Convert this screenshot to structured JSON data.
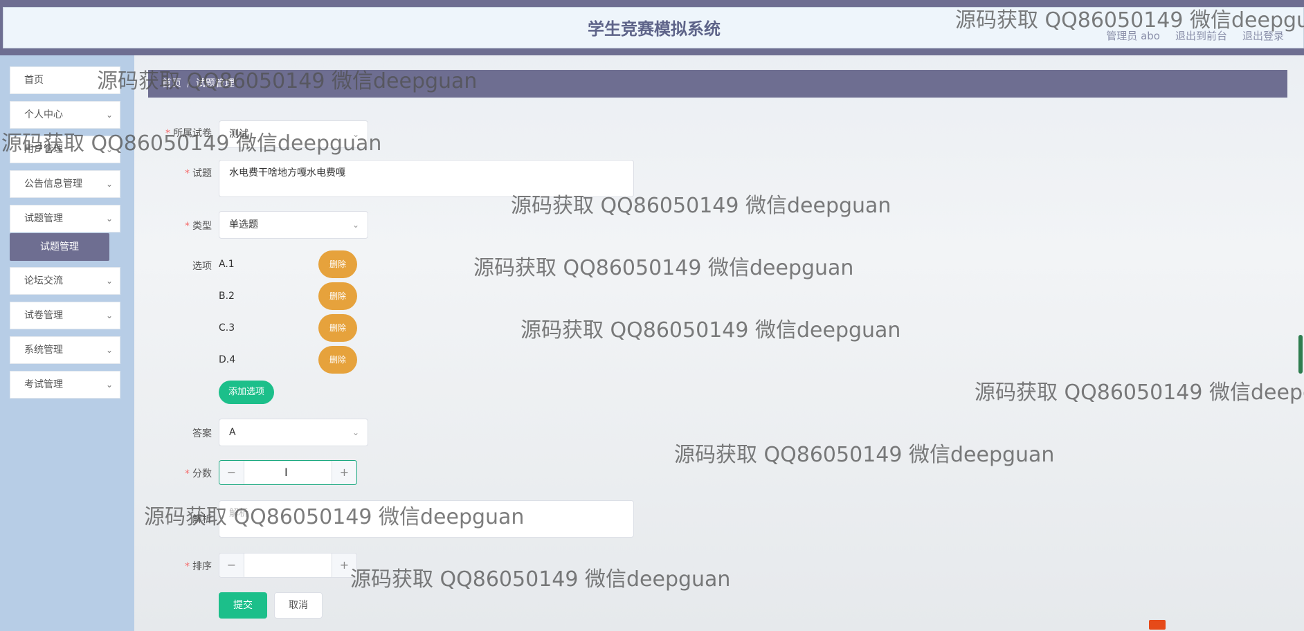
{
  "header": {
    "title": "学生竞赛模拟系统",
    "admin_label": "管理员 abo",
    "to_front_label": "退出到前台",
    "logout_label": "退出登录"
  },
  "sidebar": {
    "items": [
      {
        "label": "首页",
        "has_chevron": false
      },
      {
        "label": "个人中心",
        "has_chevron": true
      },
      {
        "label": "用户管理",
        "has_chevron": true
      },
      {
        "label": "公告信息管理",
        "has_chevron": true
      },
      {
        "label": "试题管理",
        "has_chevron": true
      },
      {
        "label": "论坛交流",
        "has_chevron": true
      },
      {
        "label": "试卷管理",
        "has_chevron": true
      },
      {
        "label": "系统管理",
        "has_chevron": true
      },
      {
        "label": "考试管理",
        "has_chevron": true
      }
    ],
    "active_subitem": "试题管理"
  },
  "breadcrumb": {
    "home": "首页",
    "sep": "/",
    "current": "试题管理"
  },
  "form": {
    "paper": {
      "label": "所属试卷",
      "value": "测试"
    },
    "question": {
      "label": "试题",
      "value": "水电费干啥地方嘎水电费嘎"
    },
    "type": {
      "label": "类型",
      "value": "单选题"
    },
    "options": {
      "label": "选项",
      "items": [
        "A.1",
        "B.2",
        "C.3",
        "D.4"
      ],
      "delete_label": "删除",
      "add_label": "添加选项"
    },
    "answer": {
      "label": "答案",
      "value": "A"
    },
    "score": {
      "label": "分数",
      "value": ""
    },
    "analysis": {
      "label": "解析",
      "placeholder": "解析"
    },
    "sort": {
      "label": "排序",
      "value": ""
    },
    "submit_label": "提交",
    "cancel_label": "取消"
  },
  "watermark_text": "源码获取 QQ86050149 微信deepguan",
  "colors": {
    "header_bar": "#6e6e91",
    "sidebar_bg": "#b7cde6",
    "accent_green": "#1cbf8a",
    "delete_orange": "#e6a23c",
    "required_red": "#f56c6c"
  }
}
